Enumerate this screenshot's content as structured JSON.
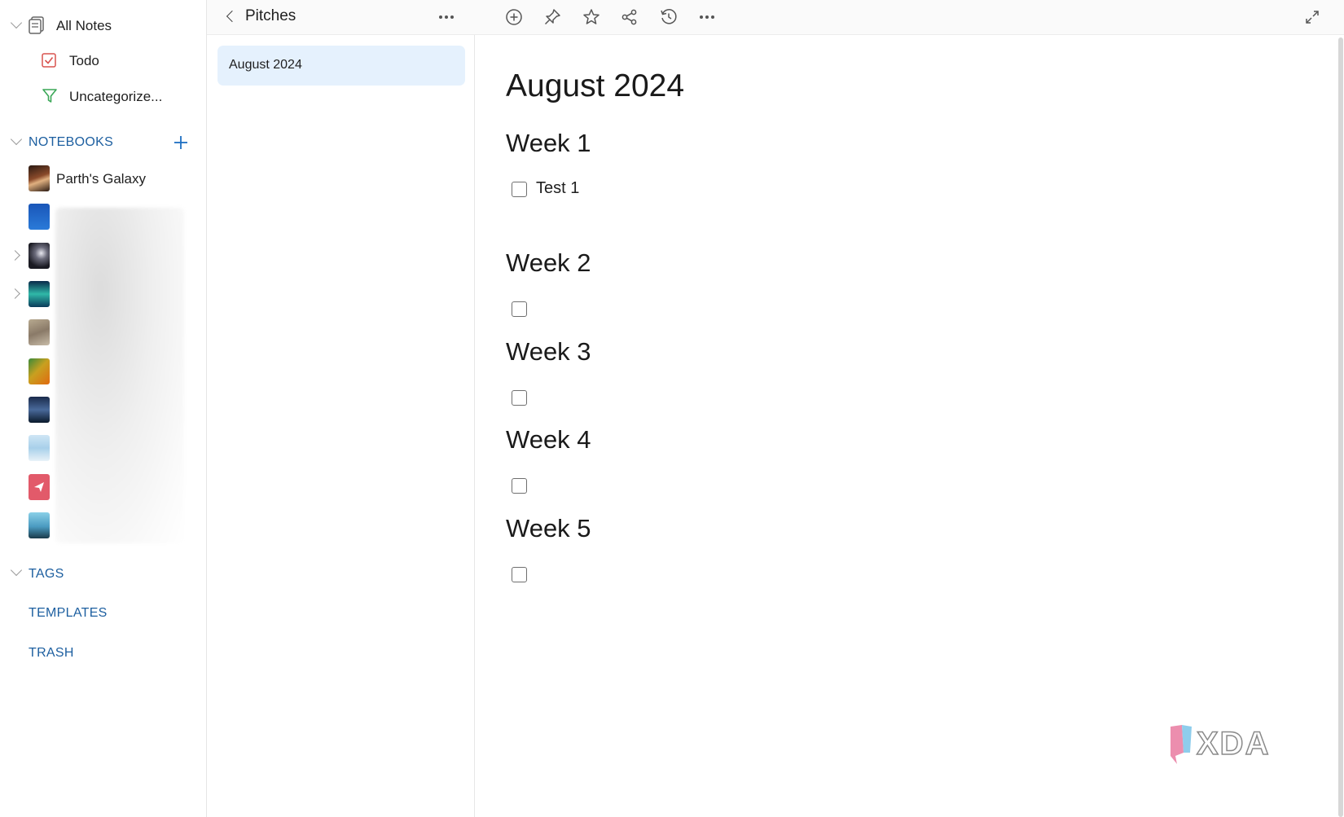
{
  "sidebar": {
    "all_notes": "All Notes",
    "todo": "Todo",
    "uncategorized": "Uncategorize...",
    "notebooks_header": "NOTEBOOKS",
    "notebook_first": "Parth's Galaxy",
    "tags": "TAGS",
    "templates": "TEMPLATES",
    "trash": "TRASH"
  },
  "notelist": {
    "title": "Pitches",
    "selected_note": "August 2024"
  },
  "editor": {
    "title": "August 2024",
    "weeks": [
      {
        "heading": "Week 1",
        "task": "Test 1"
      },
      {
        "heading": "Week 2",
        "task": ""
      },
      {
        "heading": "Week 3",
        "task": ""
      },
      {
        "heading": "Week 4",
        "task": ""
      },
      {
        "heading": "Week 5",
        "task": ""
      }
    ]
  },
  "watermark": "XDA",
  "colors": {
    "accent": "#1d5fa0",
    "selected_bg": "#e5f1fd",
    "todo_icon": "#d9534f",
    "filter_icon": "#3aa757"
  }
}
